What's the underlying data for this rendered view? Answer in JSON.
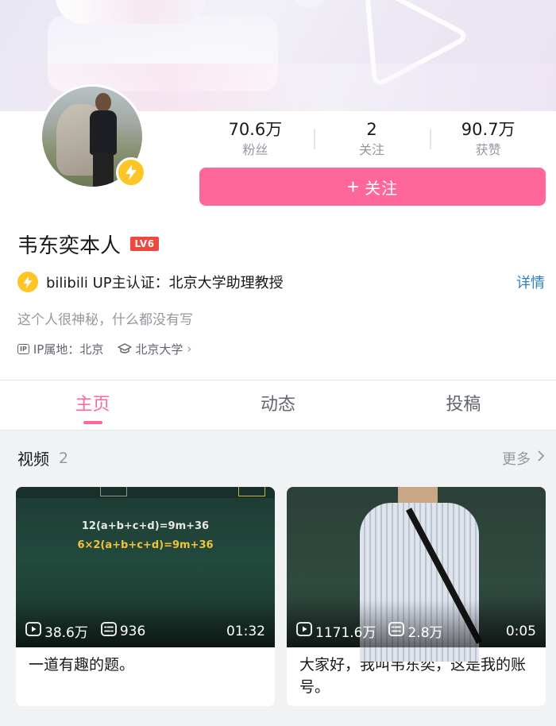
{
  "profile": {
    "name": "韦东奕本人",
    "level": "LV6",
    "stats": [
      {
        "value": "70.6万",
        "label": "粉丝"
      },
      {
        "value": "2",
        "label": "关注"
      },
      {
        "value": "90.7万",
        "label": "获赞"
      }
    ],
    "follow_label": "关注",
    "certification": "bilibili UP主认证：北京大学助理教授",
    "cert_link": "详情",
    "sign": "这个人很神秘，什么都没有写",
    "ip_tag": "IP",
    "ip_location": "IP属地：北京",
    "school": "北京大学"
  },
  "tabs": [
    {
      "label": "主页",
      "active": true
    },
    {
      "label": "动态",
      "active": false
    },
    {
      "label": "投稿",
      "active": false
    }
  ],
  "videos_section": {
    "title": "视频",
    "count": "2",
    "more_label": "更多"
  },
  "videos": [
    {
      "title": "一道有趣的题。",
      "views": "38.6万",
      "danmaku": "936",
      "duration": "01:32",
      "thumb_line1": "12(a+b+c+d)=9m+36",
      "thumb_line2": "6×2(a+b+c+d)=9m+36"
    },
    {
      "title": "大家好，我叫韦东奕，这是我的账号。",
      "views": "1171.6万",
      "danmaku": "2.8万",
      "duration": "0:05"
    }
  ],
  "colors": {
    "accent": "#ff6699",
    "link": "#2c7fc2",
    "badge": "#ffc425"
  }
}
